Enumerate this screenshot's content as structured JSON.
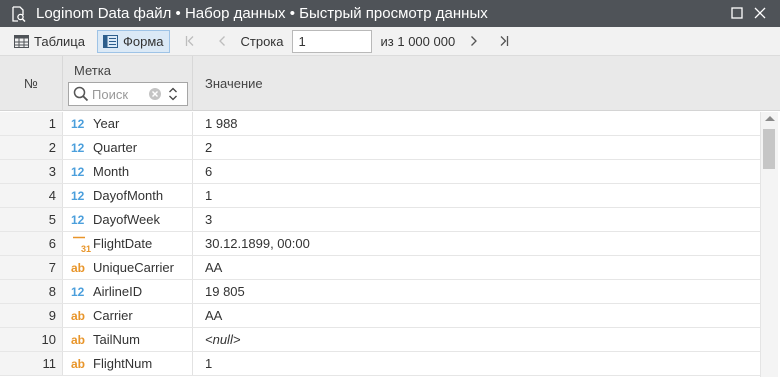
{
  "window": {
    "title": "Loginom Data файл • Набор данных • Быстрый просмотр данных",
    "icon": "document-search-icon"
  },
  "toolbar": {
    "table_label": "Таблица",
    "form_label": "Форма",
    "row_label": "Строка",
    "row_value": "1",
    "of_count": "из 1 000 000"
  },
  "header": {
    "num": "№",
    "label": "Метка",
    "value": "Значение",
    "search_placeholder": "Поиск"
  },
  "type_badges": {
    "number": "12",
    "string": "ab",
    "date": "31"
  },
  "rows": [
    {
      "num": "1",
      "type": "number",
      "name": "Year",
      "value": "1 988"
    },
    {
      "num": "2",
      "type": "number",
      "name": "Quarter",
      "value": "2"
    },
    {
      "num": "3",
      "type": "number",
      "name": "Month",
      "value": "6"
    },
    {
      "num": "4",
      "type": "number",
      "name": "DayofMonth",
      "value": "1"
    },
    {
      "num": "5",
      "type": "number",
      "name": "DayofWeek",
      "value": "3"
    },
    {
      "num": "6",
      "type": "date",
      "name": "FlightDate",
      "value": "30.12.1899, 00:00"
    },
    {
      "num": "7",
      "type": "string",
      "name": "UniqueCarrier",
      "value": "AA"
    },
    {
      "num": "8",
      "type": "number",
      "name": "AirlineID",
      "value": "19 805"
    },
    {
      "num": "9",
      "type": "string",
      "name": "Carrier",
      "value": "AA"
    },
    {
      "num": "10",
      "type": "string",
      "name": "TailNum",
      "value": "<null>",
      "is_null": true
    },
    {
      "num": "11",
      "type": "string",
      "name": "FlightNum",
      "value": "1"
    }
  ],
  "colors": {
    "titlebar": "#4f5358",
    "number_type": "#4b9fdc",
    "string_type": "#e8952a",
    "active_button": "#dbe9f6"
  }
}
